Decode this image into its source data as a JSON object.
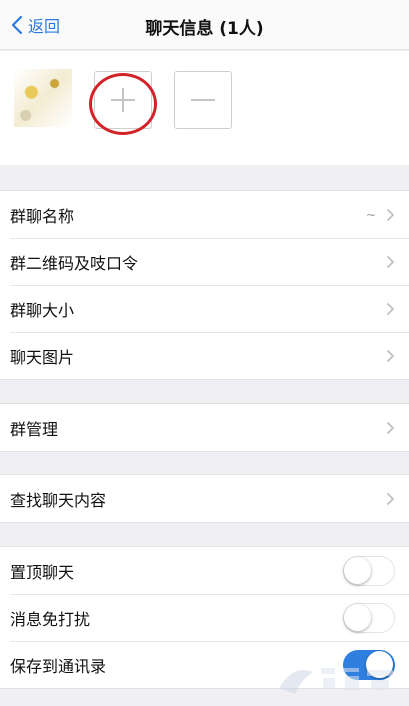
{
  "nav": {
    "back_label": "返回",
    "title": "聊天信息 (1人)"
  },
  "members": {
    "add_icon": "plus-icon",
    "remove_icon": "minus-icon"
  },
  "sections": {
    "info": [
      {
        "label": "群聊名称",
        "value": "~"
      },
      {
        "label": "群二维码及吱口令"
      },
      {
        "label": "群聊大小"
      },
      {
        "label": "聊天图片"
      }
    ],
    "manage": [
      {
        "label": "群管理"
      }
    ],
    "search": [
      {
        "label": "查找聊天内容"
      }
    ],
    "toggles": [
      {
        "label": "置顶聊天",
        "on": false
      },
      {
        "label": "消息免打扰",
        "on": false
      },
      {
        "label": "保存到通讯录",
        "on": true
      }
    ]
  },
  "colors": {
    "accent": "#2a7ae2",
    "toggle_on": "#2f7fe0",
    "highlight": "#d2232a"
  }
}
